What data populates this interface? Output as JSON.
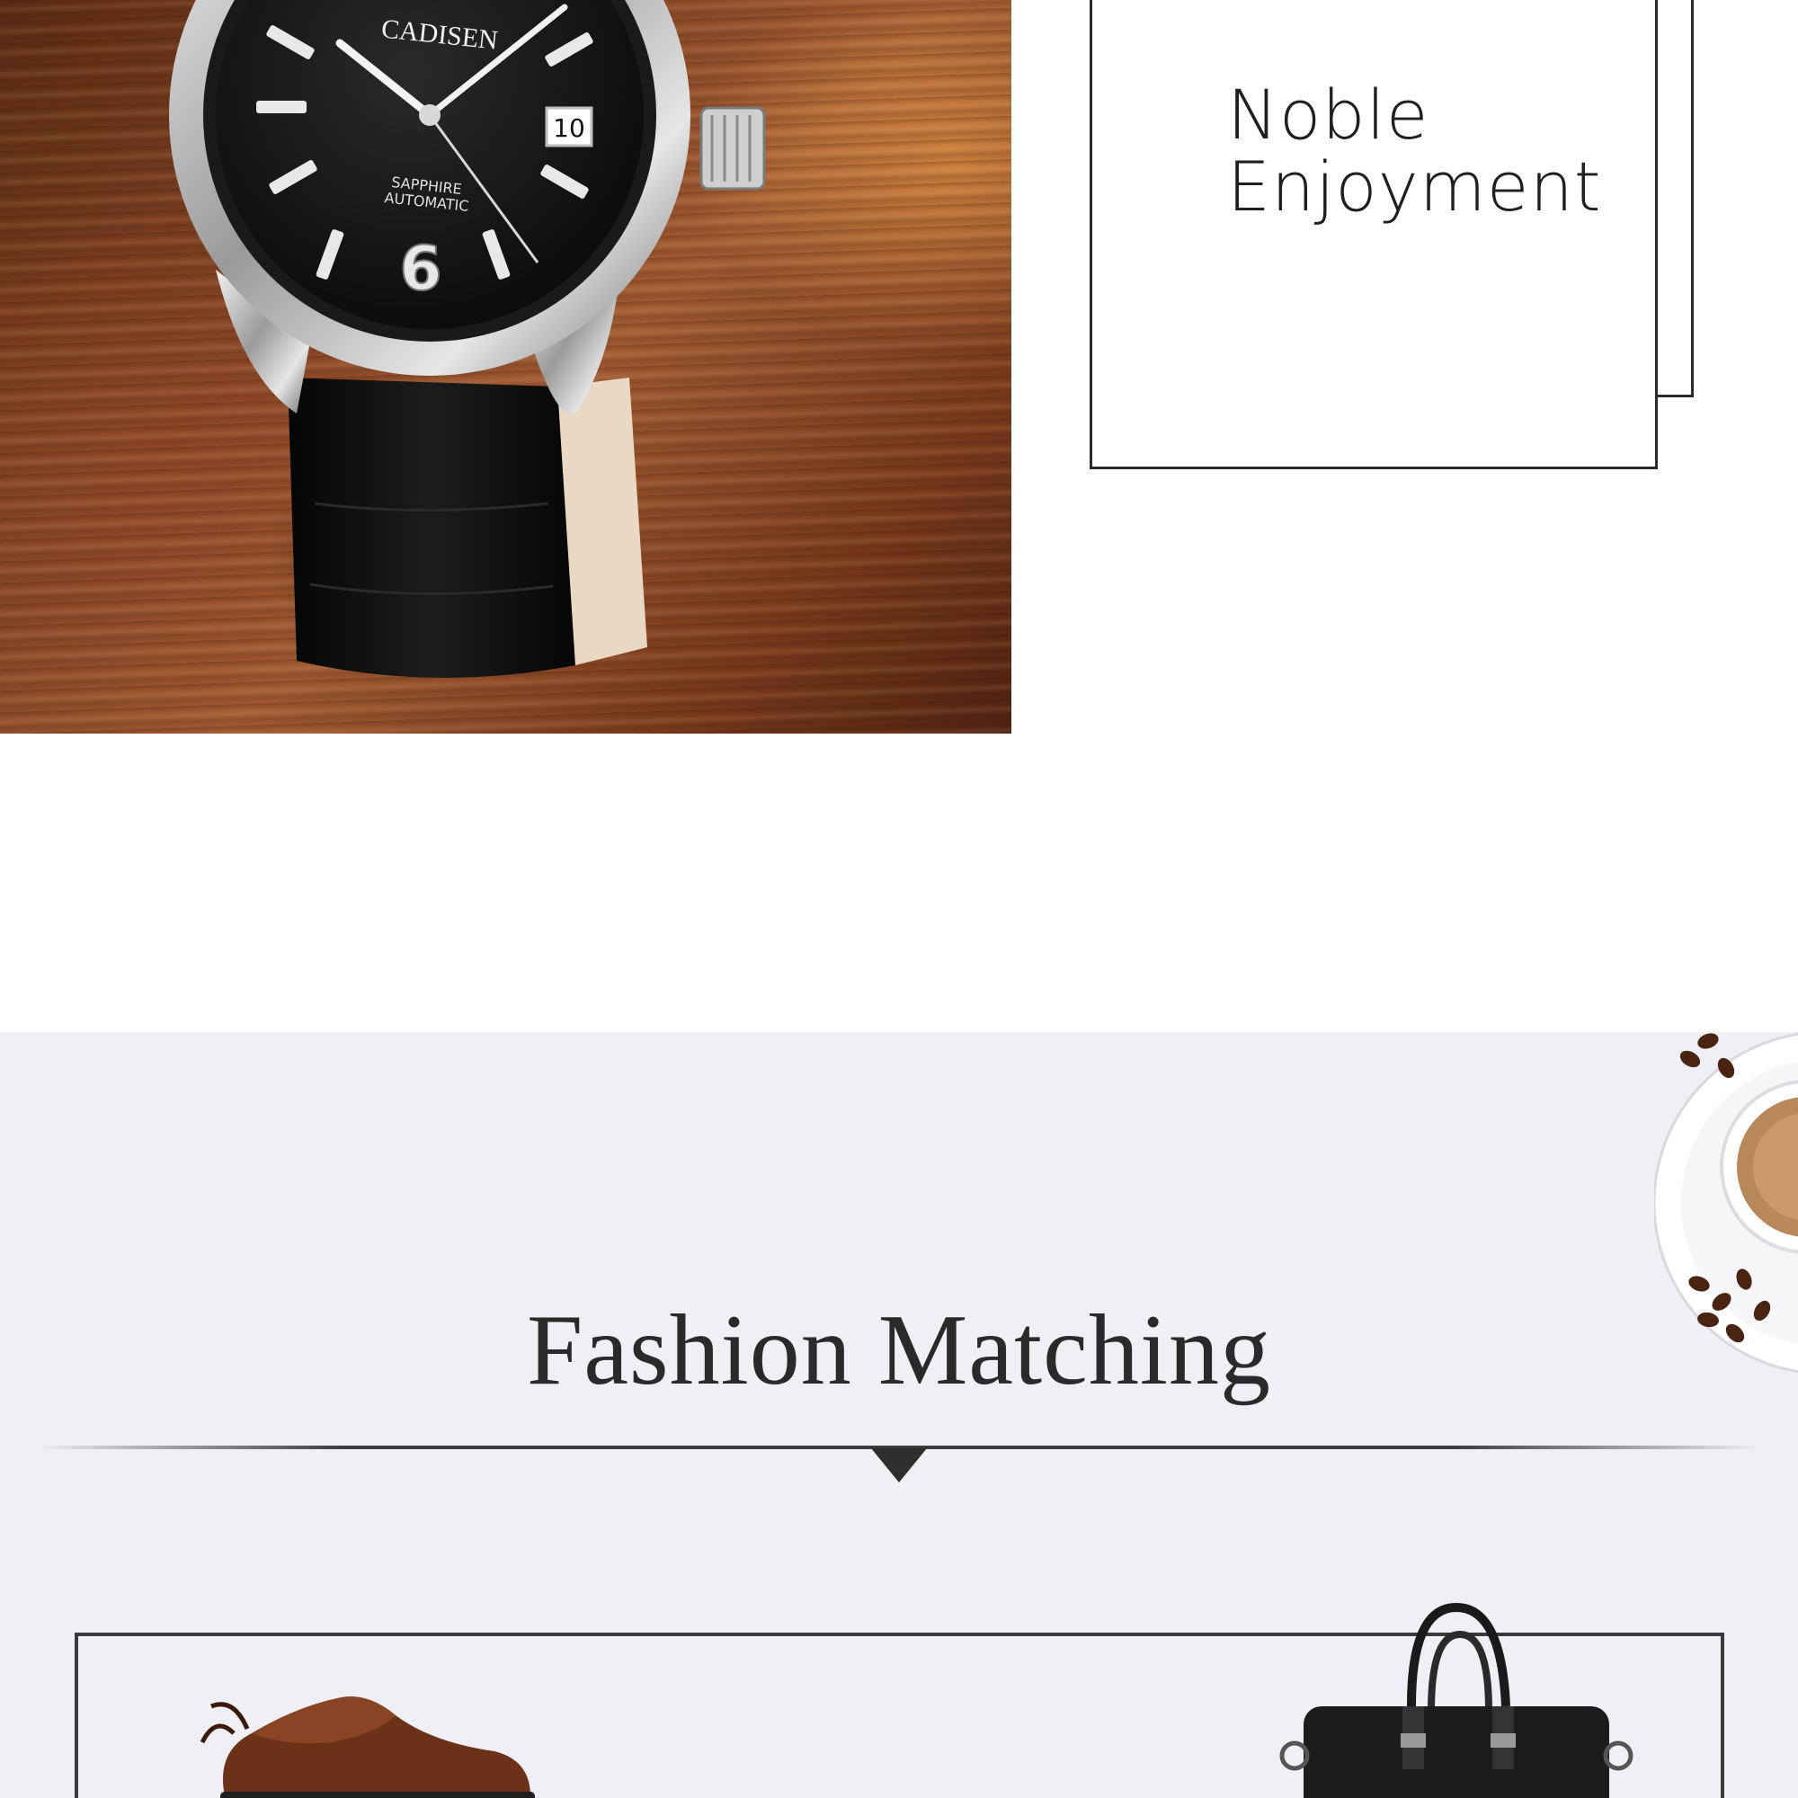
{
  "watch": {
    "brand": "CADISEN",
    "dial_line1": "SAPPHIRE",
    "dial_line2": "AUTOMATIC",
    "date_window": "10",
    "numeral": "6",
    "colors": {
      "dial": "#111111",
      "case": "#c8c8c8",
      "strap": "#0e0e0e",
      "wood": "#8a4725"
    }
  },
  "card": {
    "line1": "Noble",
    "line2": "Enjoyment"
  },
  "section": {
    "title": "Fashion Matching",
    "background": "#efeff5"
  },
  "products": {
    "shoe_icon": "leather-shoe-icon",
    "bag_icon": "leather-briefcase-icon",
    "coffee_icon": "coffee-cup-icon"
  }
}
